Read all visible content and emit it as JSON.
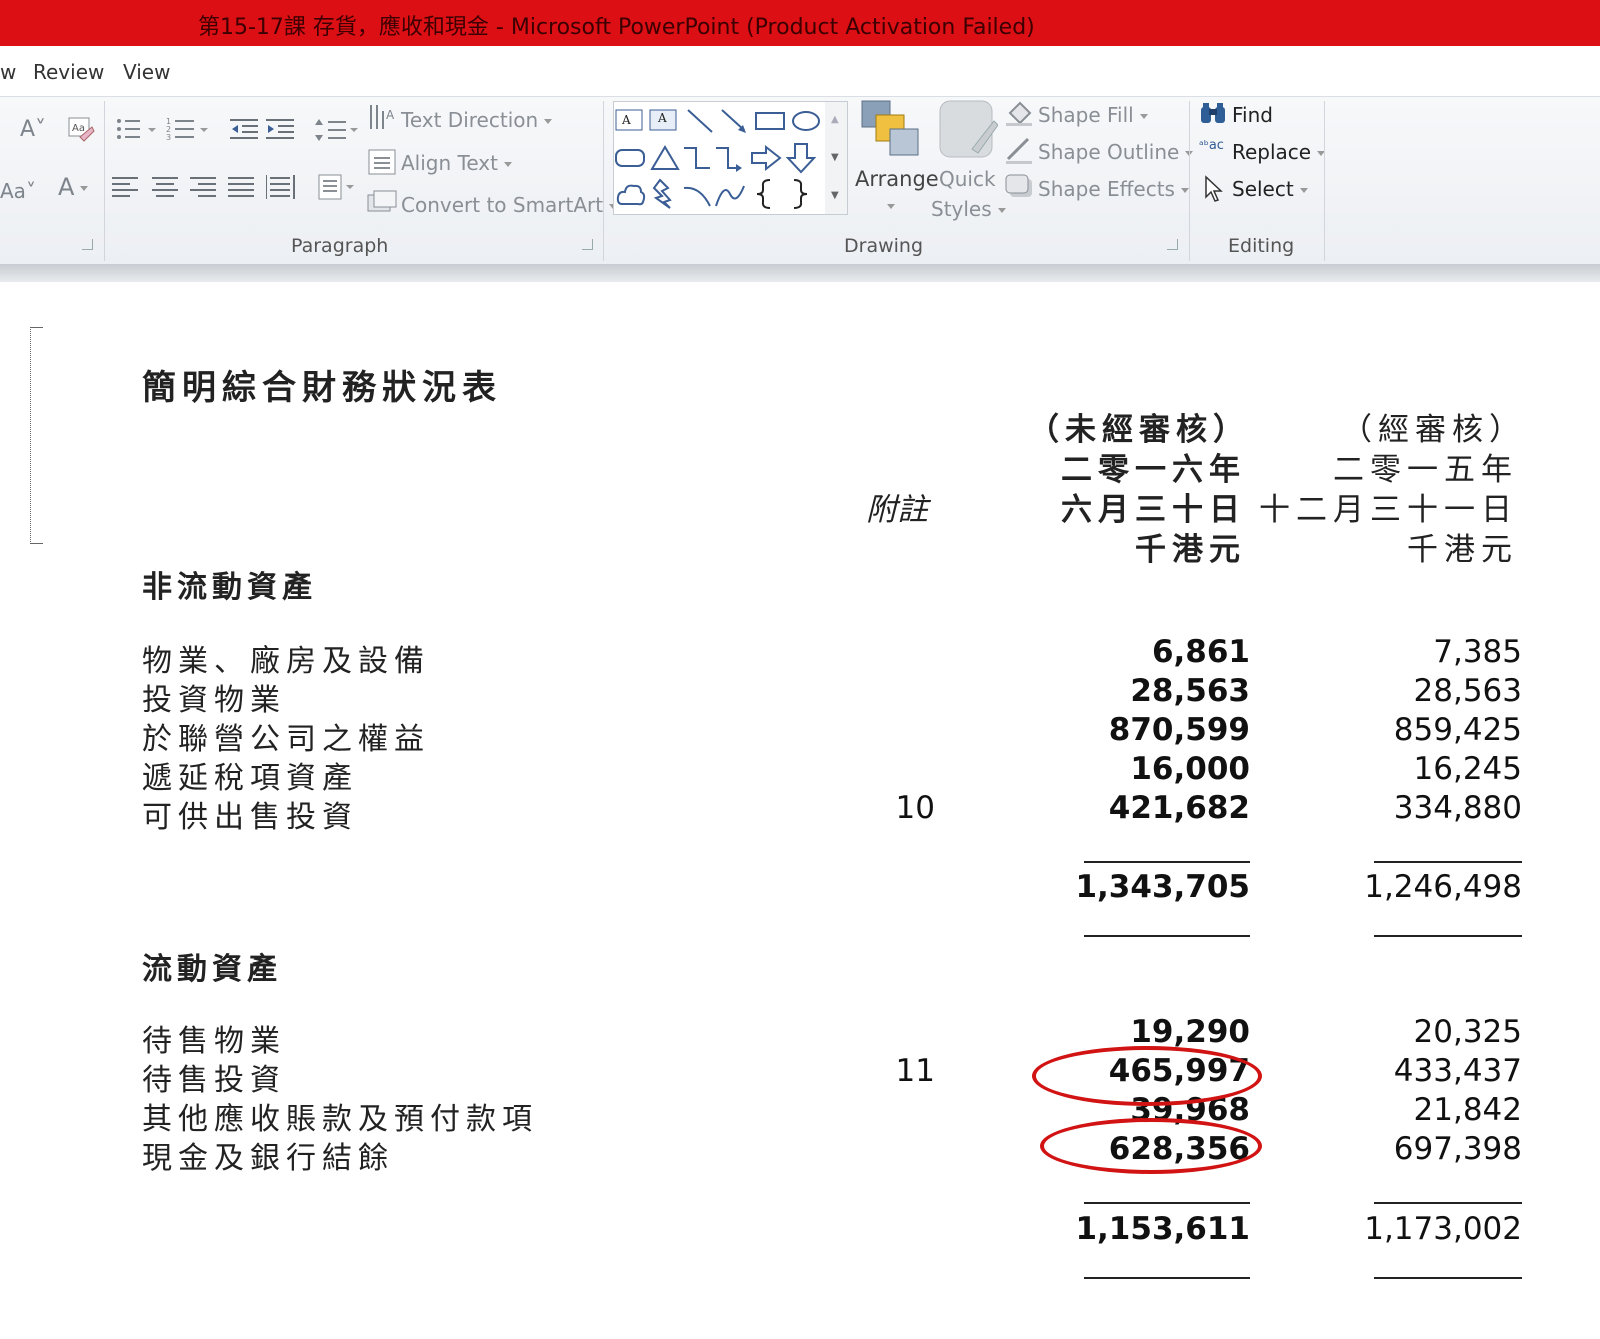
{
  "window": {
    "title": "第15-17課 存貨，應收和現金 - Microsoft PowerPoint (Product Activation Failed)"
  },
  "menu": {
    "partial_tab": "w",
    "tabs": [
      "Review",
      "View"
    ]
  },
  "ribbon": {
    "paragraph": {
      "label": "Paragraph",
      "text_direction": "Text Direction",
      "align_text": "Align Text",
      "convert_smartart": "Convert to SmartArt"
    },
    "drawing": {
      "label": "Drawing",
      "arrange": "Arrange",
      "quick_styles_1": "Quick",
      "quick_styles_2": "Styles",
      "shape_fill": "Shape Fill",
      "shape_outline": "Shape Outline",
      "shape_effects": "Shape Effects"
    },
    "editing": {
      "label": "Editing",
      "find": "Find",
      "replace": "Replace",
      "select": "Select"
    }
  },
  "document": {
    "title": "簡明綜合財務狀況表",
    "note_header": "附註",
    "col1_header": [
      "（未經審核）",
      "二零一六年",
      "六月三十日",
      "千港元"
    ],
    "col2_header": [
      "（經審核）",
      "二零一五年",
      "十二月三十一日",
      "千港元"
    ],
    "non_current": {
      "heading": "非流動資產",
      "rows": [
        {
          "label": "物業、廠房及設備",
          "note": "",
          "v2016": "6,861",
          "v2015": "7,385"
        },
        {
          "label": "投資物業",
          "note": "",
          "v2016": "28,563",
          "v2015": "28,563"
        },
        {
          "label": "於聯營公司之權益",
          "note": "",
          "v2016": "870,599",
          "v2015": "859,425"
        },
        {
          "label": "遞延稅項資產",
          "note": "",
          "v2016": "16,000",
          "v2015": "16,245"
        },
        {
          "label": "可供出售投資",
          "note": "10",
          "v2016": "421,682",
          "v2015": "334,880"
        }
      ],
      "total_2016": "1,343,705",
      "total_2015": "1,246,498"
    },
    "current": {
      "heading": "流動資產",
      "rows": [
        {
          "label": "待售物業",
          "note": "",
          "v2016": "19,290",
          "v2015": "20,325"
        },
        {
          "label": "待售投資",
          "note": "11",
          "v2016": "465,997",
          "v2015": "433,437"
        },
        {
          "label": "其他應收賬款及預付款項",
          "note": "",
          "v2016": "39,968",
          "v2015": "21,842"
        },
        {
          "label": "現金及銀行結餘",
          "note": "",
          "v2016": "628,356",
          "v2015": "697,398"
        }
      ],
      "total_2016": "1,153,611",
      "total_2015": "1,173,002"
    }
  },
  "colors": {
    "titlebar": "#dc0f14",
    "annotation": "#d21313"
  }
}
